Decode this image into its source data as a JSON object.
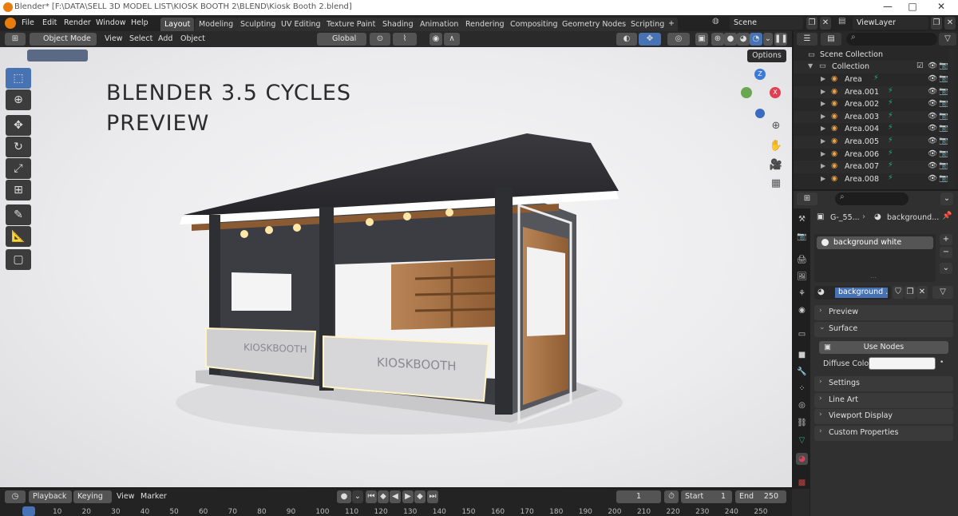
{
  "window": {
    "title": "Blender* [F:\\DATA\\SELL 3D MODEL LIST\\KIOSK BOOTH 2\\BLEND\\Kiosk Booth 2.blend]",
    "minimize": "—",
    "maximize": "□",
    "close": "✕"
  },
  "menu": {
    "items": [
      "File",
      "Edit",
      "Render",
      "Window",
      "Help"
    ]
  },
  "workspaces": [
    "Layout",
    "Modeling",
    "Sculpting",
    "UV Editing",
    "Texture Paint",
    "Shading",
    "Animation",
    "Rendering",
    "Compositing",
    "Geometry Nodes",
    "Scripting"
  ],
  "workspace_add": "+",
  "scene": {
    "name": "Scene",
    "view_layer": "ViewLayer"
  },
  "viewport_header": {
    "mode": "Object Mode",
    "menus": [
      "View",
      "Select",
      "Add",
      "Object"
    ],
    "orientation": "Global",
    "options": "Options"
  },
  "viewport": {
    "overlay_line1": "BLENDER 3.5 CYCLES",
    "overlay_line2": "PREVIEW",
    "sign_left": "KIOSKBOOTH",
    "sign_right": "KIOSKBOOTH",
    "axis_z": "Z",
    "axis_x": "X"
  },
  "outliner": {
    "root": "Scene Collection",
    "collection": "Collection",
    "items": [
      "Area",
      "Area.001",
      "Area.002",
      "Area.003",
      "Area.004",
      "Area.005",
      "Area.006",
      "Area.007",
      "Area.008"
    ]
  },
  "properties": {
    "breadcrumb_object": "G-_55...",
    "breadcrumb_material": "background...",
    "material_slot": "background white",
    "material_name": "background ...",
    "panels": [
      "Preview",
      "Surface",
      "Settings",
      "Line Art",
      "Viewport Display",
      "Custom Properties"
    ],
    "use_nodes": "Use Nodes",
    "diffuse_label": "Diffuse Color",
    "diffuse_color": "#f4f4f4"
  },
  "timeline": {
    "menus": [
      "Playback",
      "Keying",
      "View",
      "Marker"
    ],
    "current_frame": "1",
    "start_label": "Start",
    "start_value": "1",
    "end_label": "End",
    "end_value": "250",
    "ticks": [
      "1",
      "10",
      "20",
      "30",
      "40",
      "50",
      "60",
      "70",
      "80",
      "90",
      "100",
      "110",
      "120",
      "130",
      "140",
      "150",
      "160",
      "170",
      "180",
      "190",
      "200",
      "210",
      "220",
      "230",
      "240",
      "250"
    ]
  },
  "colors": {
    "accent": "#4772b3",
    "blender_orange": "#e87d0d",
    "light_object_green": "#2aa57c"
  }
}
